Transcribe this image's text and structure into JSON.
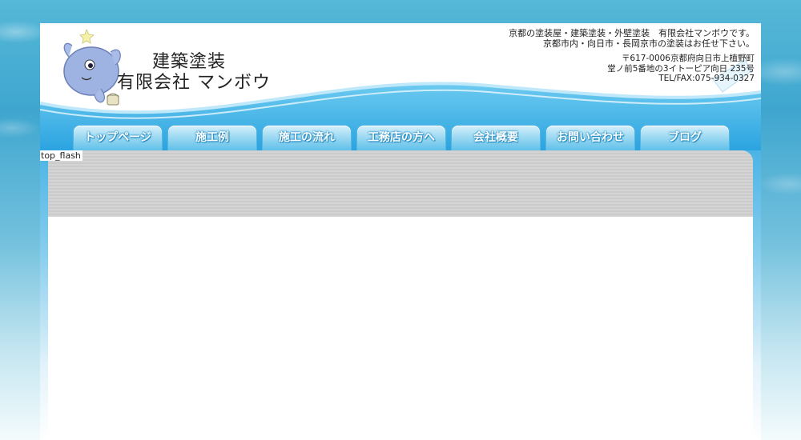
{
  "header": {
    "company_line1": "建築塗装",
    "company_line2": "有限会社 マンボウ",
    "tagline_1": "京都の塗装屋・建築塗装・外壁塗装　有限会社マンボウです。",
    "tagline_2": "京都市内・向日市・長岡京市の塗装はお任せ下さい。",
    "address_1": "〒617-0006京都府向日市上植野町",
    "address_2": "堂ノ前5番地の3イトーピア向日 235号",
    "phone": "TEL/FAX:075-934-0327",
    "mascot_icon": "sunfish-mascot-icon"
  },
  "nav": {
    "items": [
      {
        "label": "トップページ"
      },
      {
        "label": "施工例"
      },
      {
        "label": "施工の流れ"
      },
      {
        "label": "工務店の方へ"
      },
      {
        "label": "会社概要"
      },
      {
        "label": "お問い合わせ"
      },
      {
        "label": "ブログ"
      }
    ]
  },
  "content": {
    "flash_label": "top_flash"
  },
  "colors": {
    "nav_top": "#d5f0fb",
    "nav_bottom": "#5fc0e9",
    "frame_blue": "#4bb4e4",
    "flash_gray": "#d0d0d0"
  }
}
